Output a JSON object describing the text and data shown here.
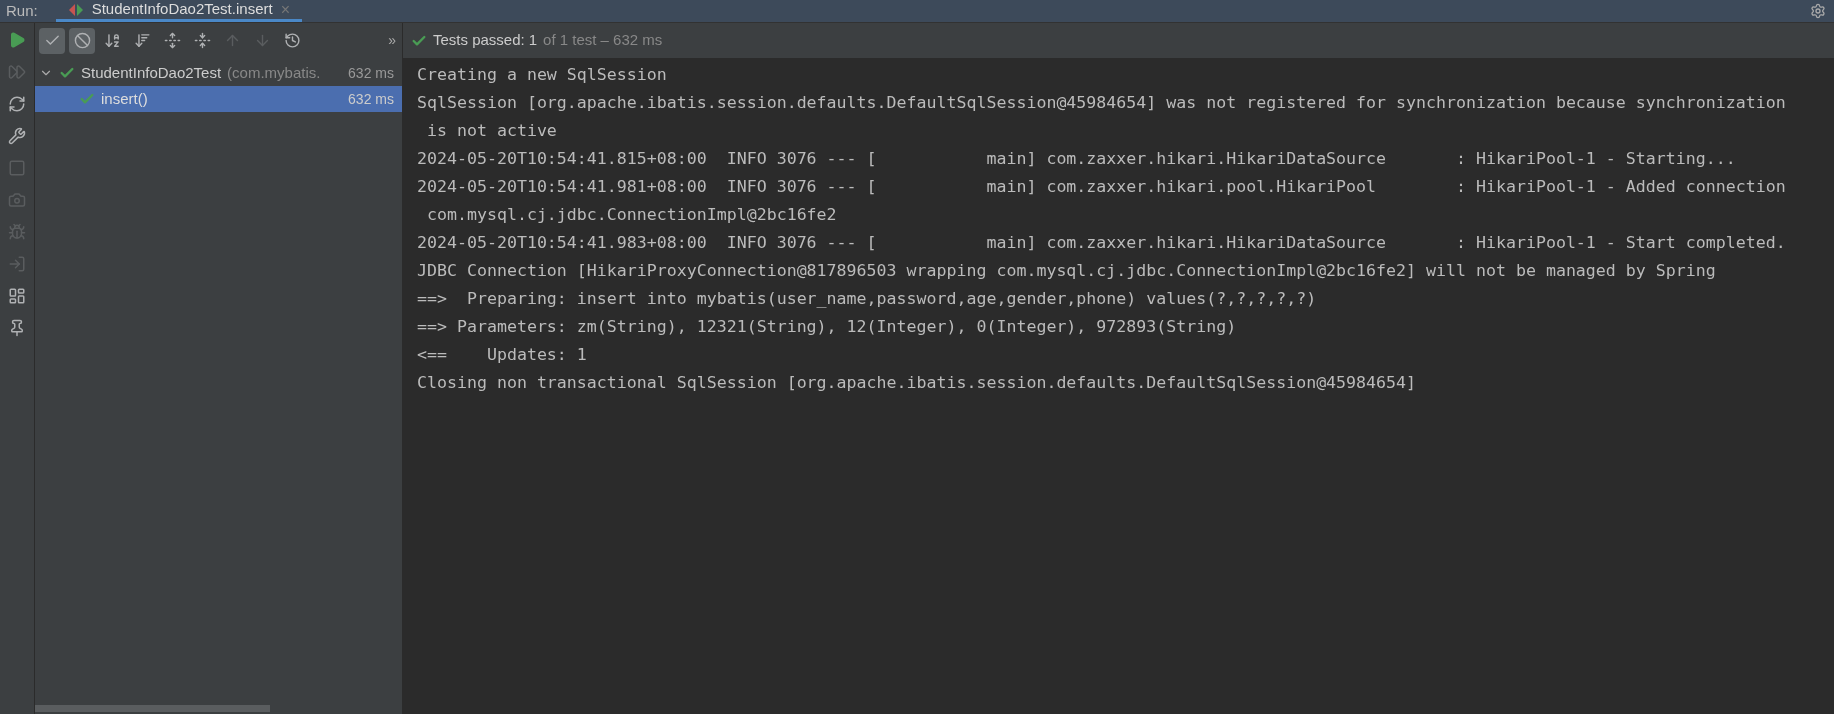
{
  "run_label": "Run:",
  "tabs": [
    {
      "label": "StudentInfoDao2Test.insert",
      "selected": true,
      "close": "×"
    }
  ],
  "side_tools": [
    {
      "kind": "run",
      "disabled": false
    },
    {
      "kind": "rerun-failed",
      "disabled": true
    },
    {
      "kind": "auto-test",
      "disabled": false
    },
    {
      "kind": "wrench",
      "disabled": false
    },
    {
      "kind": "stop",
      "disabled": true
    },
    {
      "kind": "camera",
      "disabled": true
    },
    {
      "kind": "bug",
      "disabled": true
    },
    {
      "kind": "import",
      "disabled": true
    },
    {
      "kind": "layout",
      "disabled": false
    },
    {
      "kind": "pin",
      "disabled": false
    }
  ],
  "test_tools": [
    {
      "kind": "show-passed",
      "on": true,
      "disabled": false
    },
    {
      "kind": "show-ignored",
      "on": true,
      "disabled": false
    },
    {
      "kind": "sort-alpha",
      "on": false,
      "disabled": false
    },
    {
      "kind": "sort-duration",
      "on": false,
      "disabled": false
    },
    {
      "kind": "expand-all",
      "on": false,
      "disabled": false
    },
    {
      "kind": "collapse-all",
      "on": false,
      "disabled": false
    },
    {
      "kind": "prev",
      "on": false,
      "disabled": true
    },
    {
      "kind": "next",
      "on": false,
      "disabled": true
    },
    {
      "kind": "history",
      "on": false,
      "disabled": false
    }
  ],
  "more": "»",
  "status": {
    "label": "Tests passed:",
    "count": "1",
    "detail": "of 1 test – 632 ms"
  },
  "tree": [
    {
      "name": "StudentInfoDao2Test",
      "detail": "(com.mybatis.",
      "time": "632 ms",
      "expanded": true,
      "selected": false,
      "children": [
        {
          "name": "insert()",
          "time": "632 ms",
          "selected": true
        }
      ]
    }
  ],
  "console": [
    "Creating a new SqlSession",
    "SqlSession [org.apache.ibatis.session.defaults.DefaultSqlSession@45984654] was not registered for synchronization because synchronization",
    " is not active",
    "2024-05-20T10:54:41.815+08:00  INFO 3076 --- [           main] com.zaxxer.hikari.HikariDataSource       : HikariPool-1 - Starting...",
    "2024-05-20T10:54:41.981+08:00  INFO 3076 --- [           main] com.zaxxer.hikari.pool.HikariPool        : HikariPool-1 - Added connection",
    " com.mysql.cj.jdbc.ConnectionImpl@2bc16fe2",
    "2024-05-20T10:54:41.983+08:00  INFO 3076 --- [           main] com.zaxxer.hikari.HikariDataSource       : HikariPool-1 - Start completed.",
    "JDBC Connection [HikariProxyConnection@817896503 wrapping com.mysql.cj.jdbc.ConnectionImpl@2bc16fe2] will not be managed by Spring",
    "==>  Preparing: insert into mybatis(user_name,password,age,gender,phone) values(?,?,?,?,?)",
    "==> Parameters: zm(String), 12321(String), 12(Integer), 0(Integer), 972893(String)",
    "<==    Updates: 1",
    "Closing non transactional SqlSession [org.apache.ibatis.session.defaults.DefaultSqlSession@45984654]"
  ]
}
